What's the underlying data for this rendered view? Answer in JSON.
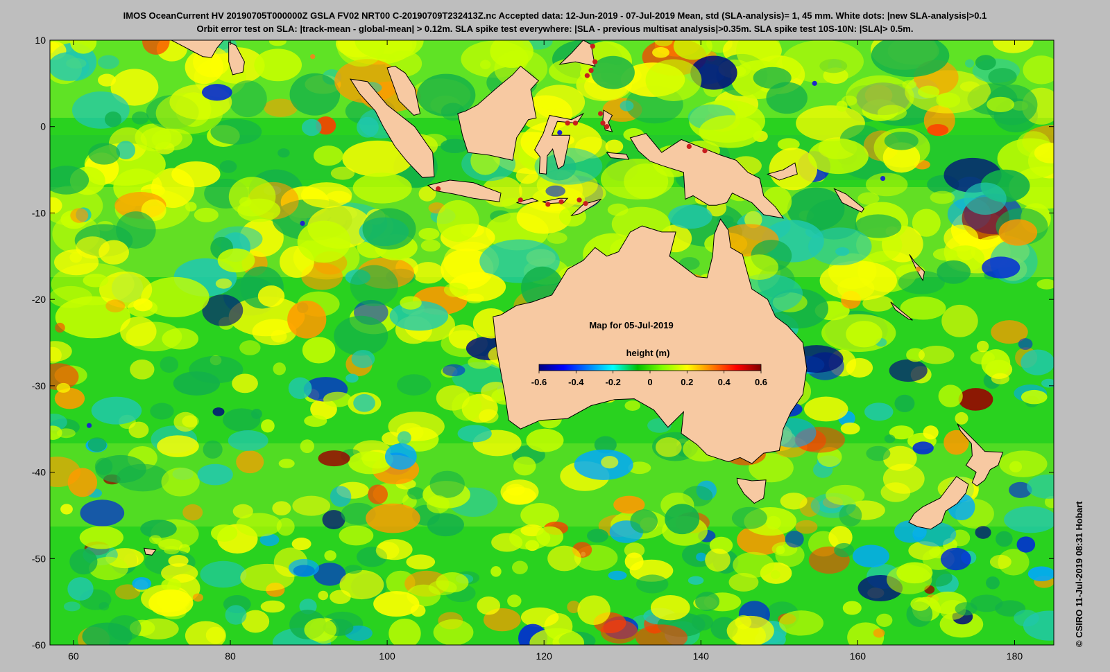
{
  "title": {
    "line1": "IMOS OceanCurrent HV 20190705T000000Z GSLA FV02 NRT00 C-20190709T232413Z.nc  Accepted data: 12-Jun-2019 - 07-Jul-2019 Mean, std (SLA-analysis)= 1, 45 mm. White dots: |new SLA-analysis|>0.1",
    "line2": "Orbit error test on SLA: |track-mean  - global-mean| > 0.12m.  SLA spike test everywhere: |SLA - previous multisat analysis|>0.35m. SLA spike test 10S-10N: |SLA|> 0.5m."
  },
  "map": {
    "lon_range": [
      57,
      185
    ],
    "lat_range": [
      -60,
      10
    ],
    "x_ticks": [
      "60",
      "80",
      "100",
      "120",
      "140",
      "160",
      "180"
    ],
    "y_ticks": [
      "10",
      "0",
      "-10",
      "-20",
      "-30",
      "-40",
      "-50",
      "-60"
    ],
    "map_label": "Map for 05-Jul-2019",
    "colorbar_title": "height (m)",
    "colorbar_ticks": [
      "-0.6",
      "-0.4",
      "-0.2",
      "0",
      "0.2",
      "0.4",
      "0.6"
    ],
    "colorbar_range": [
      -0.6,
      0.6
    ],
    "colormap": [
      "#00007f",
      "#0000ff",
      "#007fff",
      "#00ffff",
      "#00c000",
      "#7fff00",
      "#ffff00",
      "#ff7f00",
      "#ff0000",
      "#7f0000"
    ],
    "ocean_base_color": "#29d21f",
    "land_color": "#f7c9a2",
    "flag_dot_colors": {
      "red": "#c81e1e",
      "blue": "#1e28c8",
      "orange": "#e68c1e"
    }
  },
  "credit": "© CSIRO 11-Jul-2019 08:31 Hobart"
}
